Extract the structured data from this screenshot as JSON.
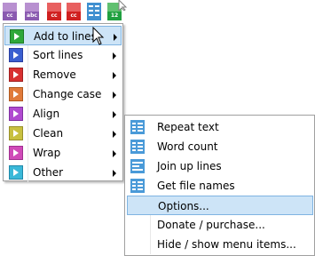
{
  "toolbar": {
    "buttons": [
      {
        "name": "cc-button",
        "text": "cc",
        "color": "#8a5ab0"
      },
      {
        "name": "abc-button",
        "text": "abc",
        "color": "#8a5ab0"
      },
      {
        "name": "remove-cc-button",
        "text": "cc",
        "color": "#d02020"
      },
      {
        "name": "remove-cc-button-2",
        "text": "cc",
        "color": "#d02020"
      },
      {
        "name": "columns-button",
        "text": "",
        "color": "#4090d0"
      },
      {
        "name": "numbered-button",
        "text": "12",
        "color": "#20a040"
      }
    ]
  },
  "main_menu": {
    "items": [
      {
        "label": "Add to lines",
        "color": "#2fa83a",
        "highlighted": true
      },
      {
        "label": "Sort lines",
        "color": "#3a5fd0",
        "highlighted": false
      },
      {
        "label": "Remove",
        "color": "#d83030",
        "highlighted": false
      },
      {
        "label": "Change case",
        "color": "#e07a3a",
        "highlighted": false
      },
      {
        "label": "Align",
        "color": "#b04ad0",
        "highlighted": false
      },
      {
        "label": "Clean",
        "color": "#c8c040",
        "highlighted": false
      },
      {
        "label": "Wrap",
        "color": "#d04ab8",
        "highlighted": false
      },
      {
        "label": "Other",
        "color": "#3ab8d8",
        "highlighted": false
      }
    ]
  },
  "sub_menu": {
    "items": [
      {
        "label": "Repeat text",
        "icon": "list-icon",
        "highlighted": false
      },
      {
        "label": "Word count",
        "icon": "list-icon",
        "highlighted": false
      },
      {
        "label": "Join up lines",
        "icon": "list-icon",
        "highlighted": false
      },
      {
        "label": "Get file names",
        "icon": "list-icon",
        "highlighted": false
      },
      {
        "label": "Options...",
        "icon": "",
        "highlighted": true
      },
      {
        "label": "Donate / purchase...",
        "icon": "",
        "highlighted": false
      },
      {
        "label": "Hide / show menu items...",
        "icon": "",
        "highlighted": false
      }
    ]
  }
}
